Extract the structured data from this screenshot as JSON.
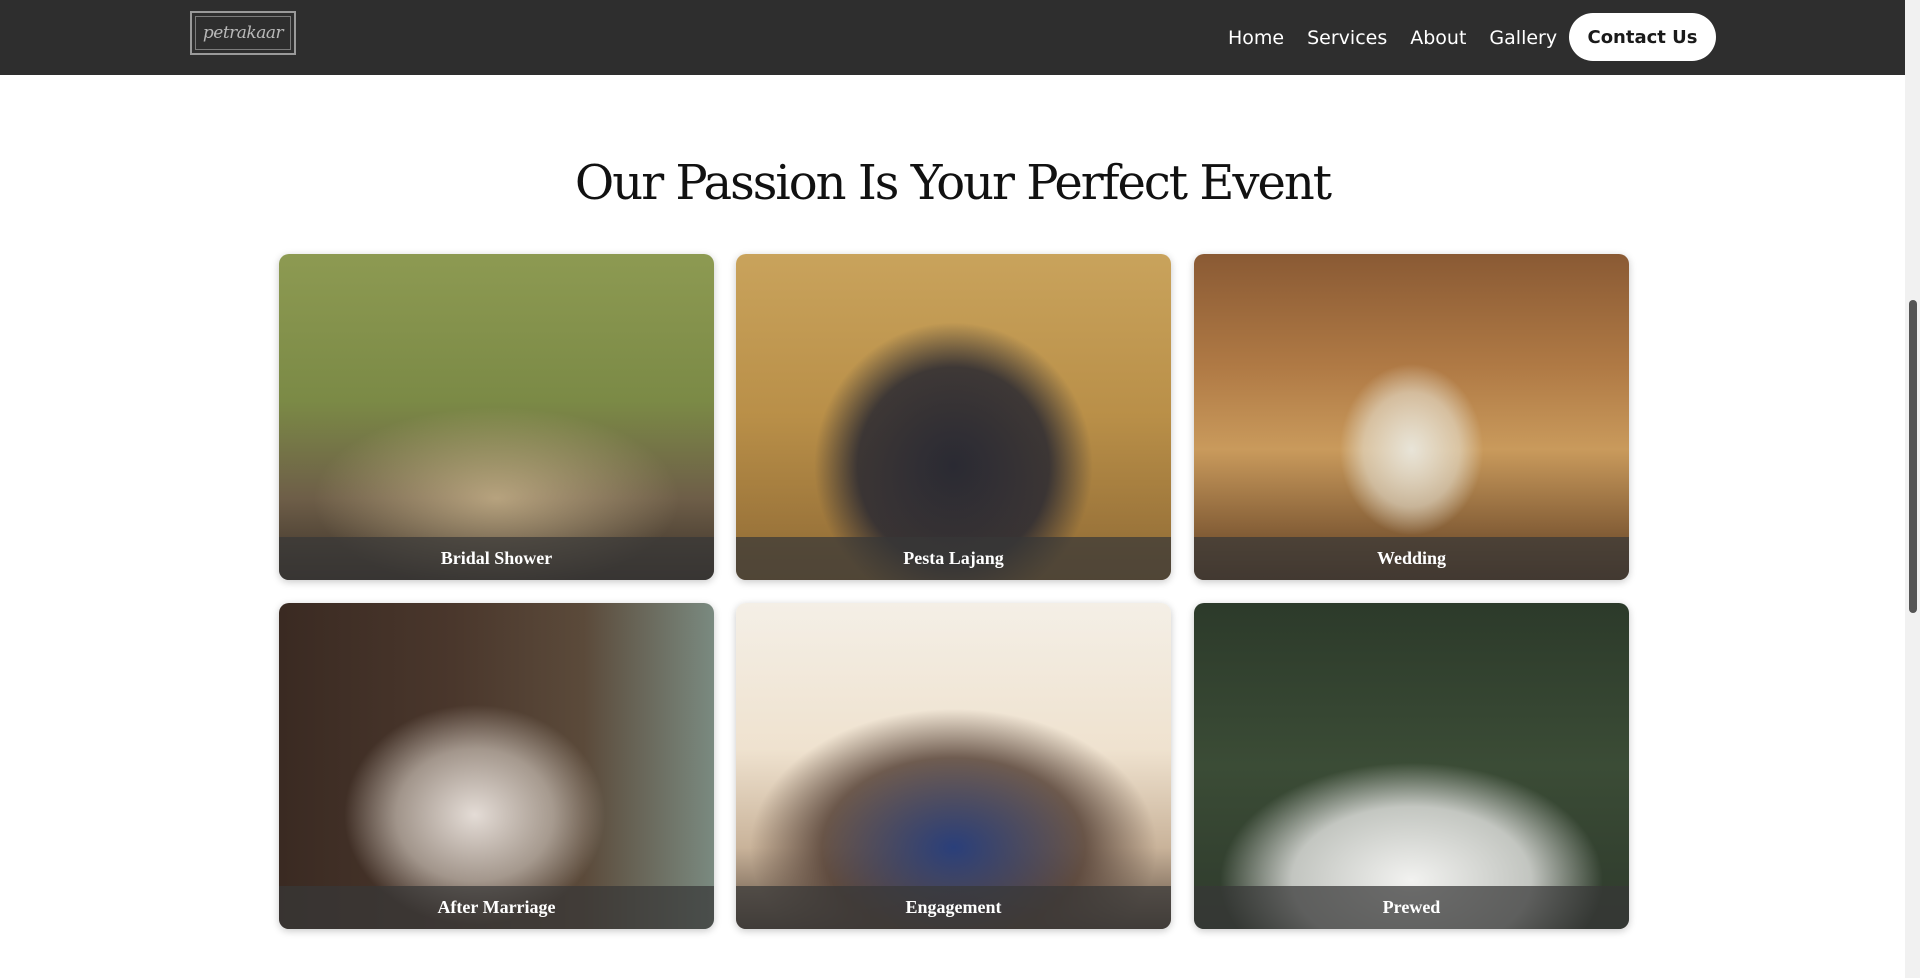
{
  "header": {
    "logo_text": "petrakaar",
    "nav": [
      "Home",
      "Services",
      "About",
      "Gallery"
    ],
    "contact_label": "Contact Us"
  },
  "main": {
    "heading": "Our Passion Is Your Perfect Event",
    "cards": [
      {
        "label": "Bridal Shower"
      },
      {
        "label": "Pesta Lajang"
      },
      {
        "label": "Wedding"
      },
      {
        "label": "After Marriage"
      },
      {
        "label": "Engagement"
      },
      {
        "label": "Prewed"
      }
    ]
  },
  "colors": {
    "navbar_bg": "#2e2e2e",
    "button_bg": "#ffffff",
    "caption_overlay": "#373737"
  }
}
